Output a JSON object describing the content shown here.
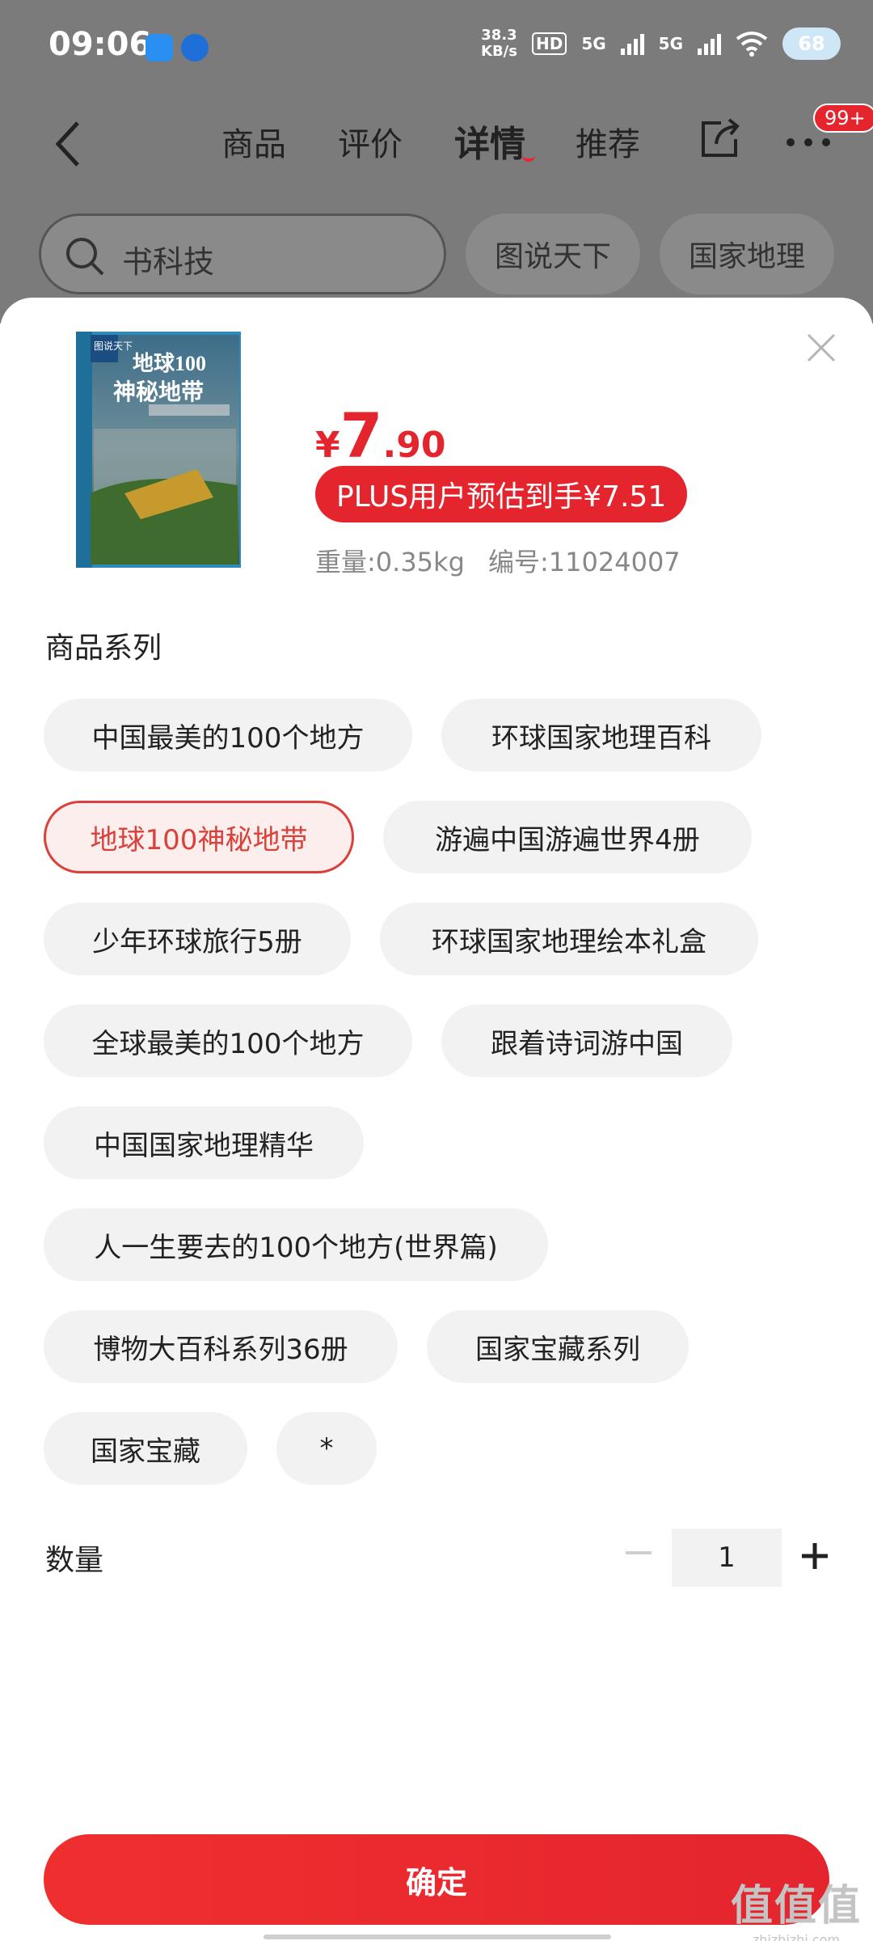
{
  "status_bar": {
    "time": "09:06",
    "net_speed_value": "38.3",
    "net_speed_unit": "KB/s",
    "hd_label": "HD",
    "signal_1": "5G",
    "signal_2": "5G",
    "battery": "68"
  },
  "nav": {
    "tabs": [
      "商品",
      "评价",
      "详情",
      "推荐"
    ],
    "active_tab": "详情",
    "badge": "99+"
  },
  "search": {
    "query": "书科技",
    "chips": [
      "图说天下",
      "国家地理"
    ]
  },
  "product": {
    "cover_title_line1": "地球100",
    "cover_title_line2": "神秘地带",
    "cover_series_label": "图说天下",
    "price_symbol": "¥",
    "price_integer": "7",
    "price_decimal": ".90",
    "plus_price_text": "PLUS用户预估到手¥7.51",
    "weight": "重量:0.35kg",
    "sku": "编号:11024007"
  },
  "series": {
    "title": "商品系列",
    "options": [
      "中国最美的100个地方",
      "环球国家地理百科",
      "地球100神秘地带",
      "游遍中国游遍世界4册",
      "少年环球旅行5册",
      "环球国家地理绘本礼盒",
      "全球最美的100个地方",
      "跟着诗词游中国",
      "中国国家地理精华",
      "人一生要去的100个地方(世界篇)",
      "博物大百科系列36册",
      "国家宝藏系列",
      "国家宝藏",
      "*"
    ],
    "selected": "地球100神秘地带"
  },
  "quantity": {
    "label": "数量",
    "value": "1"
  },
  "confirm_label": "确定",
  "watermark": {
    "logo": "值值值",
    "url": "zhizhizhi.com"
  },
  "colors": {
    "accent": "#e4252e",
    "selected_border": "#d9413a",
    "overlay": "#7b7b7b"
  }
}
